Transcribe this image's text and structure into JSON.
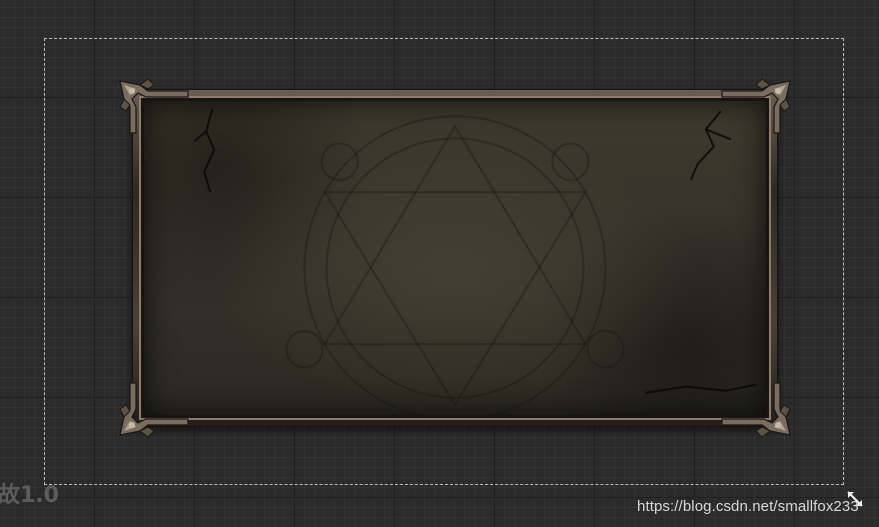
{
  "canvas": {
    "ghost_text": "故1.0",
    "watermark": "https://blog.csdn.net/smallfox233"
  },
  "icons": {
    "resize": "resize-diagonal-icon",
    "corner": "ornate-corner-icon"
  },
  "colors": {
    "background": "#2b2b2c",
    "panel_stone": "#34322a",
    "frame_metal": "#8c7c6c"
  }
}
